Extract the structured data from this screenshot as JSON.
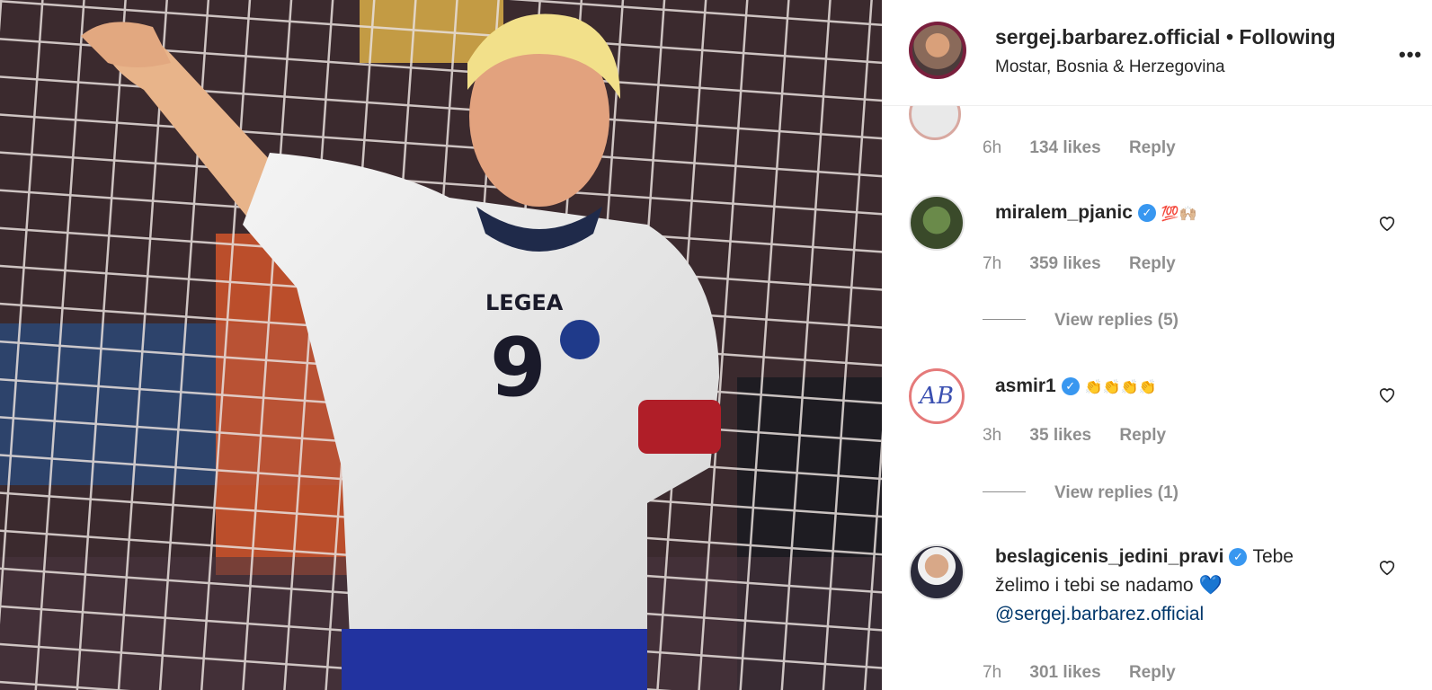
{
  "header": {
    "username": "sergej.barbarez.official",
    "separator": "•",
    "follow_status": "Following",
    "location": "Mostar, Bosnia & Herzegovina",
    "more_icon": "more-options-icon"
  },
  "comments": [
    {
      "time": "6h",
      "likes": "134 likes",
      "reply": "Reply"
    },
    {
      "username": "miralem_pjanic",
      "text": "💯🙌🏼",
      "time": "7h",
      "likes": "359 likes",
      "reply": "Reply",
      "view_replies": "View replies (5)"
    },
    {
      "username": "asmir1",
      "text": "👏👏👏👏",
      "time": "3h",
      "likes": "35 likes",
      "reply": "Reply",
      "view_replies": "View replies (1)"
    },
    {
      "username": "beslagicenis_jedini_pravi",
      "text_line1": "Tebe",
      "text_line2": "želimo i tebi se nadamo",
      "heart": "💙",
      "mention": "@sergej.barbarez.official",
      "time": "7h",
      "likes": "301 likes",
      "reply": "Reply"
    }
  ],
  "photo": {
    "jersey_brand": "LEGEA",
    "jersey_number": "9"
  },
  "colors": {
    "verified": "#3897f0",
    "meta_gray": "#8e8e8e",
    "mention_blue": "#00376b",
    "teal_heart": "#20b2c8"
  }
}
